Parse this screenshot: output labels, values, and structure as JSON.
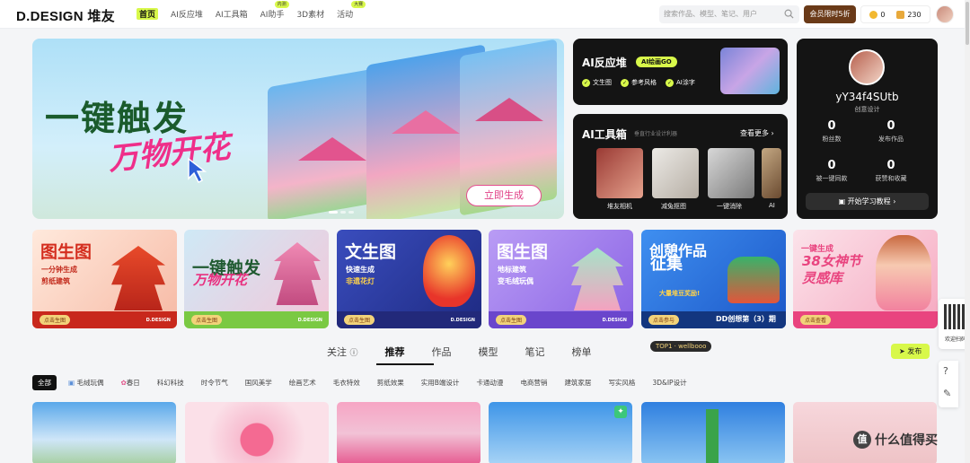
{
  "header": {
    "logo": "D.DESIGN 堆友",
    "nav": [
      {
        "label": "首页",
        "active": true,
        "badge": ""
      },
      {
        "label": "AI反应堆",
        "active": false,
        "badge": ""
      },
      {
        "label": "AI工具箱",
        "active": false,
        "badge": ""
      },
      {
        "label": "AI助手",
        "active": false,
        "badge": "内测"
      },
      {
        "label": "3D素材",
        "active": false,
        "badge": ""
      },
      {
        "label": "活动",
        "active": false,
        "badge": "大赛"
      }
    ],
    "search_placeholder": "搜索作品、模型、笔记、用户",
    "vip_label": "会员限时5折",
    "coins": "0",
    "points": "230"
  },
  "hero": {
    "title": "一键触发",
    "subtitle": "万物开花",
    "button": "立即生成"
  },
  "ai_react": {
    "title": "AI反应堆",
    "pill": "AI绘画GO",
    "features": [
      "文生图",
      "参考风格",
      "AI涂字"
    ]
  },
  "ai_tools": {
    "title": "AI工具箱",
    "subtitle": "垂直行业设计利器",
    "more": "查看更多",
    "tools": [
      "堆友相机",
      "减兔抠图",
      "一键消除",
      "AI"
    ]
  },
  "user": {
    "name": "yY34f4SUtb",
    "role": "创意设计",
    "stats": [
      {
        "n": "0",
        "l": "粉丝数"
      },
      {
        "n": "0",
        "l": "发布作品"
      },
      {
        "n": "0",
        "l": "被一键同款"
      },
      {
        "n": "0",
        "l": "获赞和收藏"
      }
    ],
    "learn": "开始学习教程"
  },
  "promos": [
    {
      "title": "图生图",
      "desc1": "一分钟生成",
      "desc2": "剪纸建筑",
      "btn": "点击生图",
      "brand": "D.DESIGN",
      "tag": ""
    },
    {
      "title": "一键触发",
      "desc1": "万物开花",
      "desc2": "",
      "btn": "点击生图",
      "brand": "D.DESIGN",
      "tag": ""
    },
    {
      "title": "文生图",
      "desc1": "快速生成",
      "desc2": "非遗花灯",
      "btn": "点击生图",
      "brand": "D.DESIGN",
      "tag": ""
    },
    {
      "title": "图生图",
      "desc1": "地标建筑",
      "desc2": "变毛绒玩偶",
      "btn": "点击生图",
      "brand": "D.DESIGN",
      "tag": ""
    },
    {
      "title": "创憩作品",
      "desc1": "征集",
      "desc2": "大量堆豆奖励!",
      "btn": "点击参与",
      "brand": "",
      "tag": "DD创想第（3）期"
    },
    {
      "title": "一键生成",
      "desc1": "38女神节",
      "desc2": "灵感库",
      "btn": "点击查看",
      "brand": "",
      "tag": ""
    }
  ],
  "tabs": [
    "关注",
    "推荐",
    "作品",
    "模型",
    "笔记",
    "榜单"
  ],
  "top1": "TOP1 · wellbooo",
  "publish": "发布",
  "categories": [
    "全部",
    "毛绒玩偶",
    "春日",
    "科幻科技",
    "时令节气",
    "国风美学",
    "绘画艺术",
    "毛衣特效",
    "剪纸效果",
    "实用B端设计",
    "卡通动漫",
    "电商营销",
    "建筑家居",
    "写实风格",
    "3D&IP设计"
  ],
  "side": {
    "scan": "欢迎扫码"
  },
  "watermark": "什么值得买",
  "colors": {
    "accent": "#d8f84a",
    "vip": "#6a3a18",
    "hero_pink": "#ef2f8a"
  }
}
